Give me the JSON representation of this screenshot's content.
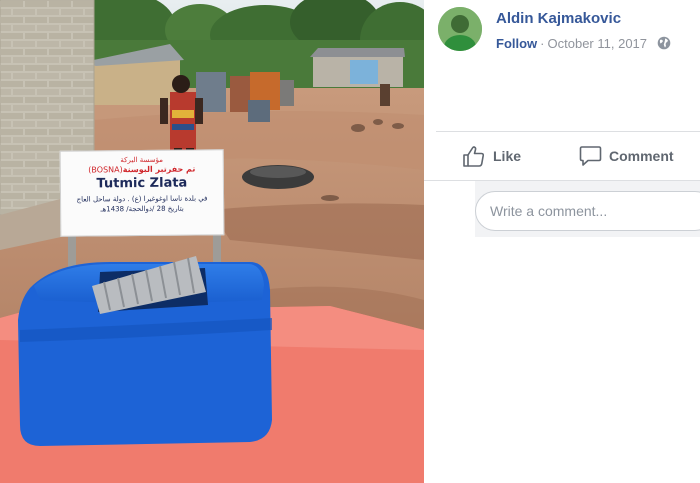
{
  "photo": {
    "sign": {
      "line1": "مؤسسة البركة",
      "line2_arabic": "تم حفرتبر البوسنة",
      "line2_tag": "(BOSNA)",
      "title": "Tutmic Zlata",
      "line3": "في بلدة ناسا اوغوغيرا (ع) . دولة ساحل العاج",
      "line4": "بتاريخ 28 /ذوالحجة/ 1438هـ"
    }
  },
  "post": {
    "author": "Aldin Kajmakovic",
    "follow_label": "Follow",
    "separator": "·",
    "date": "October 11, 2017",
    "privacy_icon": "globe-icon"
  },
  "actions": {
    "like_label": "Like",
    "like_icon": "thumbs-up-icon",
    "comment_label": "Comment",
    "comment_icon": "speech-bubble-icon"
  },
  "comment_box": {
    "placeholder": "Write a comment..."
  },
  "colors": {
    "link": "#365899",
    "muted": "#90949c",
    "action": "#606770",
    "well_blue": "#1d63d6",
    "slab_red": "#f07b6d"
  }
}
